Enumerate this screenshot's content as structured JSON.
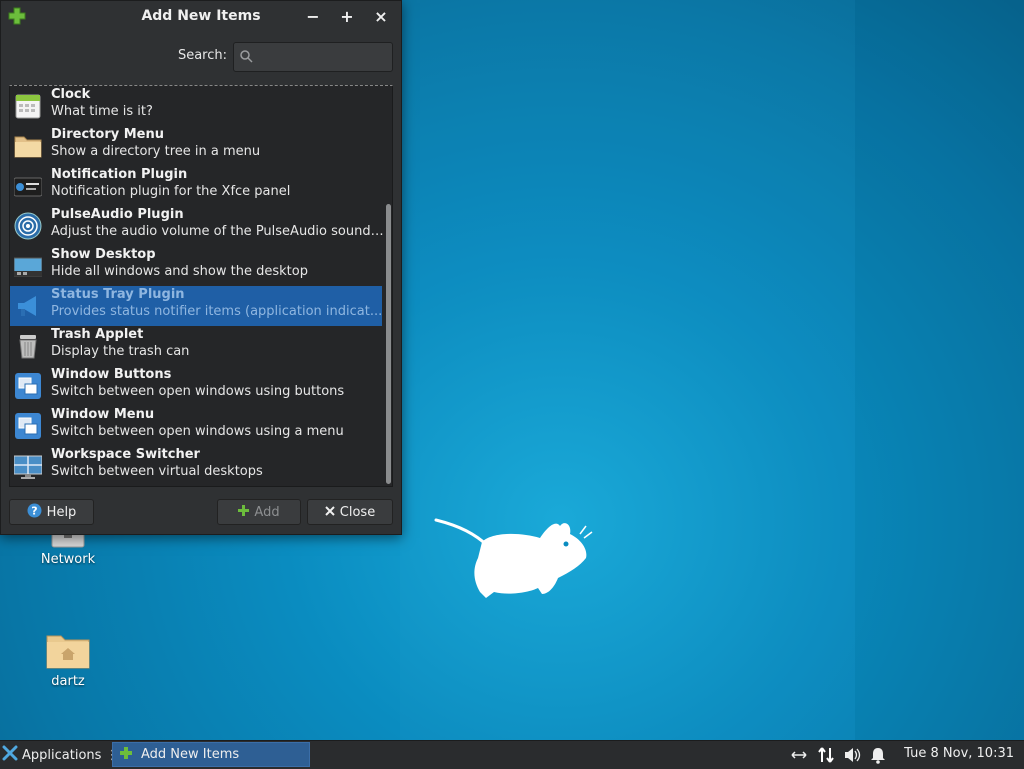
{
  "dialog": {
    "title": "Add New Items",
    "window_buttons": {
      "minimize": "−",
      "maximize": "+",
      "close": "×"
    },
    "search": {
      "label": "Search:",
      "placeholder": "",
      "value": ""
    },
    "items": [
      {
        "name": "Clock",
        "desc": "What time is it?",
        "icon": "calendar-icon",
        "selected": false
      },
      {
        "name": "Directory Menu",
        "desc": "Show a directory tree in a menu",
        "icon": "folder-icon",
        "selected": false
      },
      {
        "name": "Notification Plugin",
        "desc": "Notification plugin for the Xfce panel",
        "icon": "notification-icon",
        "selected": false
      },
      {
        "name": "PulseAudio Plugin",
        "desc": "Adjust the audio volume of the PulseAudio sound ...",
        "icon": "speaker-icon",
        "selected": false
      },
      {
        "name": "Show Desktop",
        "desc": "Hide all windows and show the desktop",
        "icon": "desktop-icon",
        "selected": false
      },
      {
        "name": "Status Tray Plugin",
        "desc": "Provides status notifier items (application indicat...",
        "icon": "megaphone-icon",
        "selected": true
      },
      {
        "name": "Trash Applet",
        "desc": "Display the trash can",
        "icon": "trash-icon",
        "selected": false
      },
      {
        "name": "Window Buttons",
        "desc": "Switch between open windows using buttons",
        "icon": "windows-icon",
        "selected": false
      },
      {
        "name": "Window Menu",
        "desc": "Switch between open windows using a menu",
        "icon": "windows-icon",
        "selected": false
      },
      {
        "name": "Workspace Switcher",
        "desc": "Switch between virtual desktops",
        "icon": "workspace-icon",
        "selected": false
      }
    ],
    "buttons": {
      "help": "Help",
      "add": "Add",
      "close": "Close"
    }
  },
  "desktop": {
    "icons": [
      {
        "label": "Network",
        "icon": "network-icon"
      },
      {
        "label": "dartz",
        "icon": "home-folder-icon"
      }
    ]
  },
  "taskbar": {
    "applications": "Applications",
    "separator": "⋮",
    "task": "Add New Items",
    "clock": "Tue  8 Nov, 10:31"
  },
  "colors": {
    "accent": "#1f5fa6",
    "panel": "#2a2c2e",
    "desktop": "#0a8cc0"
  }
}
